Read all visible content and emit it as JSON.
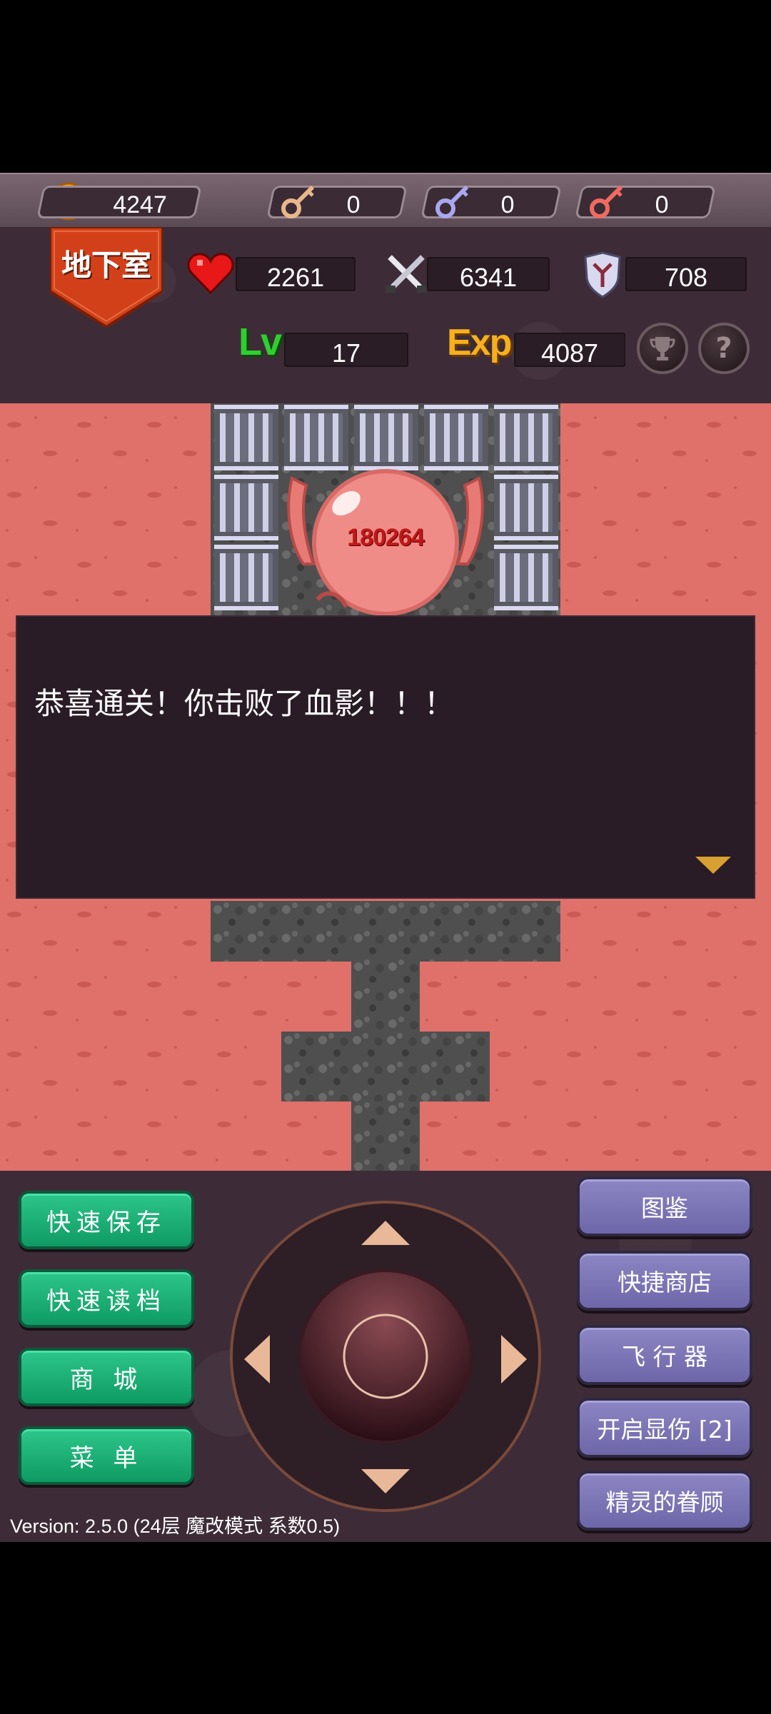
{
  "resources": {
    "gold": "4247",
    "yellow_keys": "0",
    "blue_keys": "0",
    "red_keys": "0"
  },
  "floor": {
    "name": "地下室"
  },
  "stats": {
    "hp": "2261",
    "attack": "6341",
    "defense": "708",
    "level_label": "Lv",
    "level": "17",
    "exp_label": "Exp",
    "exp": "4087",
    "help_symbol": "?"
  },
  "map": {
    "damage_text": "180264"
  },
  "dialog": {
    "message": "恭喜通关！你击败了血影！！！"
  },
  "left_buttons": {
    "quick_save": "快速保存",
    "quick_load": "快速读档",
    "shop": "商 城",
    "menu": "菜 单"
  },
  "right_buttons": {
    "encyclopedia": "图鉴",
    "quick_shop": "快捷商店",
    "flyer": "飞 行 器",
    "show_damage": "开启显伤 [2]",
    "spirit_favor": "精灵的眷顾"
  },
  "version": "Version: 2.5.0 (24层 魔改模式 系数0.5)",
  "colors": {
    "lava": "#e0706a",
    "stone": "#4f4f4f",
    "panel": "#3d2c37",
    "green_button": "#1cae76",
    "purple_button": "#7d76b6",
    "floor_banner": "#d2401a"
  }
}
